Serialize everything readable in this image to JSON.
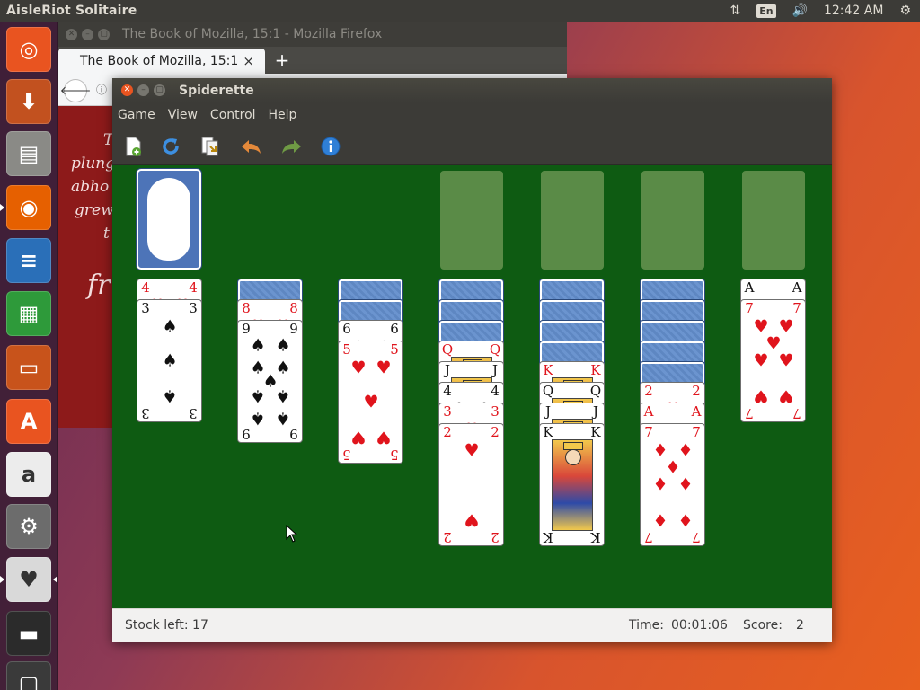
{
  "top_panel": {
    "app_title": "AisleRiot Solitaire",
    "language": "En",
    "clock": "12:42 AM",
    "icons": [
      "network-icon",
      "keyboard-language-icon",
      "volume-icon",
      "power-gear-icon"
    ]
  },
  "launcher": {
    "items": [
      {
        "name": "ubuntu-dash",
        "color": "#e95420",
        "glyph": "◎"
      },
      {
        "name": "system-installer",
        "color": "#c2511f",
        "glyph": "⬇"
      },
      {
        "name": "files",
        "color": "#8a8a86",
        "glyph": "▤"
      },
      {
        "name": "firefox",
        "color": "#e66000",
        "glyph": "◉"
      },
      {
        "name": "libreoffice-writer",
        "color": "#2a6fb8",
        "glyph": "≡"
      },
      {
        "name": "libreoffice-calc",
        "color": "#2e9a3a",
        "glyph": "▦"
      },
      {
        "name": "libreoffice-impress",
        "color": "#c8531b",
        "glyph": "▭"
      },
      {
        "name": "ubuntu-software",
        "color": "#e95420",
        "glyph": "A"
      },
      {
        "name": "amazon",
        "color": "#ececec",
        "glyph": "a"
      },
      {
        "name": "system-settings",
        "color": "#6c6c6c",
        "glyph": "⚙"
      },
      {
        "name": "aisleriot-solitaire",
        "color": "#d9d9d9",
        "glyph": "♥"
      },
      {
        "name": "disk-drive",
        "color": "#2b2b2b",
        "glyph": "▬"
      },
      {
        "name": "trash",
        "color": "#3a3a3a",
        "glyph": "▢"
      }
    ]
  },
  "firefox": {
    "window_title": "The Book of Mozilla, 15:1 - Mozilla Firefox",
    "tab_title": "The Book of Mozilla, 15:1",
    "tab_close": "×",
    "new_tab": "+",
    "back_glyph": "🡐",
    "info_glyph": "ⓘ",
    "visible_text_fragments": [
      "T",
      "plung",
      "abho",
      "grew",
      "t",
      "fr"
    ]
  },
  "spiderette": {
    "window_title": "Spiderette",
    "menu": [
      "Game",
      "View",
      "Control",
      "Help"
    ],
    "toolbar": [
      "new-game-icon",
      "restart-icon",
      "deal-icon",
      "undo-icon",
      "redo-icon",
      "help-info-icon"
    ],
    "status": {
      "stock_label": "Stock left: 17",
      "time_label": "Time:",
      "time_value": "00:01:06",
      "score_label": "Score:",
      "score_value": "2"
    },
    "foundations_empty": 4,
    "tableau": [
      {
        "hidden": 0,
        "faces": [
          [
            "4",
            "♥",
            "red"
          ],
          [
            "3",
            "♠",
            "black"
          ]
        ]
      },
      {
        "hidden": 1,
        "faces": [
          [
            "8",
            "♥",
            "red"
          ],
          [
            "9",
            "♠",
            "black"
          ]
        ]
      },
      {
        "hidden": 2,
        "faces": [
          [
            "6",
            "♠",
            "black"
          ],
          [
            "5",
            "♥",
            "red"
          ]
        ]
      },
      {
        "hidden": 3,
        "faces": [
          [
            "Q",
            "♦",
            "red"
          ],
          [
            "J",
            "♠",
            "black"
          ],
          [
            "4",
            "♣",
            "black"
          ],
          [
            "3",
            "♥",
            "red"
          ],
          [
            "2",
            "♥",
            "red"
          ]
        ]
      },
      {
        "hidden": 4,
        "faces": [
          [
            "K",
            "♦",
            "red"
          ],
          [
            "Q",
            "♠",
            "black"
          ],
          [
            "J",
            "♠",
            "black"
          ],
          [
            "K",
            "♣",
            "black"
          ]
        ]
      },
      {
        "hidden": 5,
        "faces": [
          [
            "2",
            "♥",
            "red"
          ],
          [
            "A",
            "♥",
            "red"
          ],
          [
            "7",
            "♦",
            "red"
          ]
        ]
      },
      {
        "hidden": 0,
        "faces": [
          [
            "A",
            "♠",
            "black"
          ],
          [
            "7",
            "♥",
            "red"
          ]
        ]
      }
    ]
  }
}
